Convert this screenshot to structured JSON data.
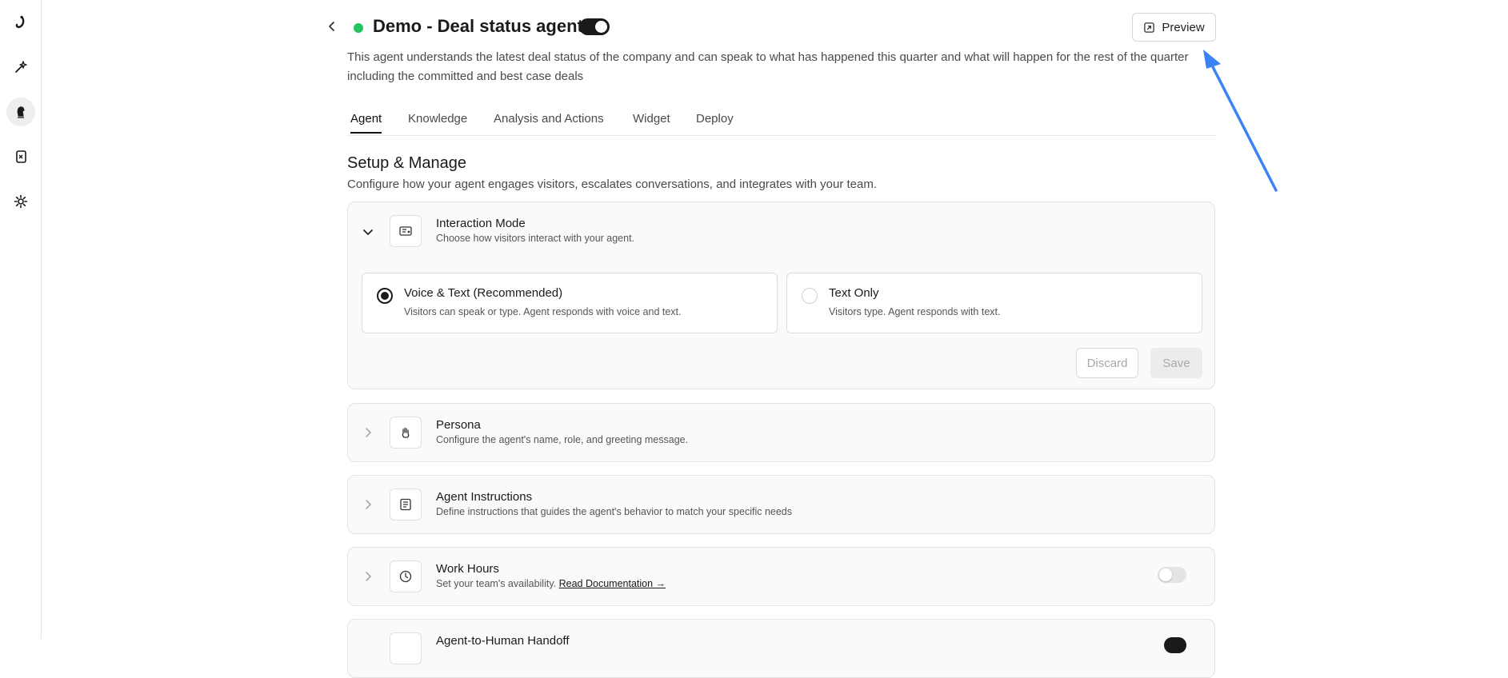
{
  "colors": {
    "status_active": "#22c55e",
    "toggle_on": "#1a1a1a",
    "annotation_arrow": "#3b82f6"
  },
  "rail": {
    "items": [
      {
        "icon": "brand-logo-icon"
      },
      {
        "icon": "sparkle-wand-icon"
      },
      {
        "icon": "agent-chess-knight-icon",
        "active": true
      },
      {
        "icon": "book-document-icon"
      },
      {
        "icon": "gear-icon"
      }
    ]
  },
  "header": {
    "title": "Demo - Deal status agent",
    "agent_enabled": true,
    "preview_label": "Preview",
    "description": "This agent understands the latest deal status of the company and can speak to what has happened this quarter and what will happen for the rest of the quarter including the committed and best case deals"
  },
  "tabs": [
    {
      "label": "Agent",
      "active": true
    },
    {
      "label": "Knowledge"
    },
    {
      "label": "Analysis and Actions"
    },
    {
      "label": "Widget"
    },
    {
      "label": "Deploy"
    }
  ],
  "section": {
    "title": "Setup & Manage",
    "subtitle": "Configure how your agent engages visitors, escalates conversations, and integrates with your team."
  },
  "interaction_mode": {
    "title": "Interaction Mode",
    "subtitle": "Choose how visitors interact with your agent.",
    "options": [
      {
        "title": "Voice & Text (Recommended)",
        "subtitle": "Visitors can speak or type. Agent responds with voice and text.",
        "selected": true
      },
      {
        "title": "Text Only",
        "subtitle": "Visitors type. Agent responds with text.",
        "selected": false
      }
    ],
    "discard_label": "Discard",
    "save_label": "Save"
  },
  "persona": {
    "title": "Persona",
    "subtitle": "Configure the agent's name, role, and greeting message."
  },
  "instructions": {
    "title": "Agent Instructions",
    "subtitle": "Define instructions that guides the agent's behavior to match your specific needs"
  },
  "work_hours": {
    "title": "Work Hours",
    "subtitle": "Set your team's availability.",
    "link": "Read Documentation →",
    "enabled": false
  },
  "handoff": {
    "title": "Agent-to-Human Handoff"
  }
}
